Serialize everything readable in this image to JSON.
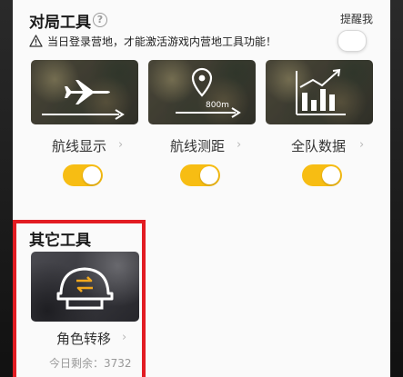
{
  "match_tools": {
    "title": "对局工具",
    "help_icon_glyph": "?",
    "remind_label": "提醒我",
    "remind_enabled": false,
    "warning": "当日登录营地，才能激活游戏内营地工具功能！",
    "tools": [
      {
        "label": "航线显示",
        "icon": "airplane-route-icon",
        "enabled": true
      },
      {
        "label": "航线测距",
        "icon": "location-pin-distance-icon",
        "distance_text": "800m",
        "enabled": true
      },
      {
        "label": "全队数据",
        "icon": "bar-chart-trend-icon",
        "enabled": true
      }
    ]
  },
  "other_tools": {
    "title": "其它工具",
    "tools": [
      {
        "label": "角色转移",
        "icon": "helmet-swap-icon",
        "remaining": "今日剩余：3732"
      }
    ]
  },
  "chevron_glyph": "›",
  "colors": {
    "toggle_on": "#f7bd13",
    "highlight_border": "#e21c22",
    "panel_bg": "#fafafa"
  }
}
